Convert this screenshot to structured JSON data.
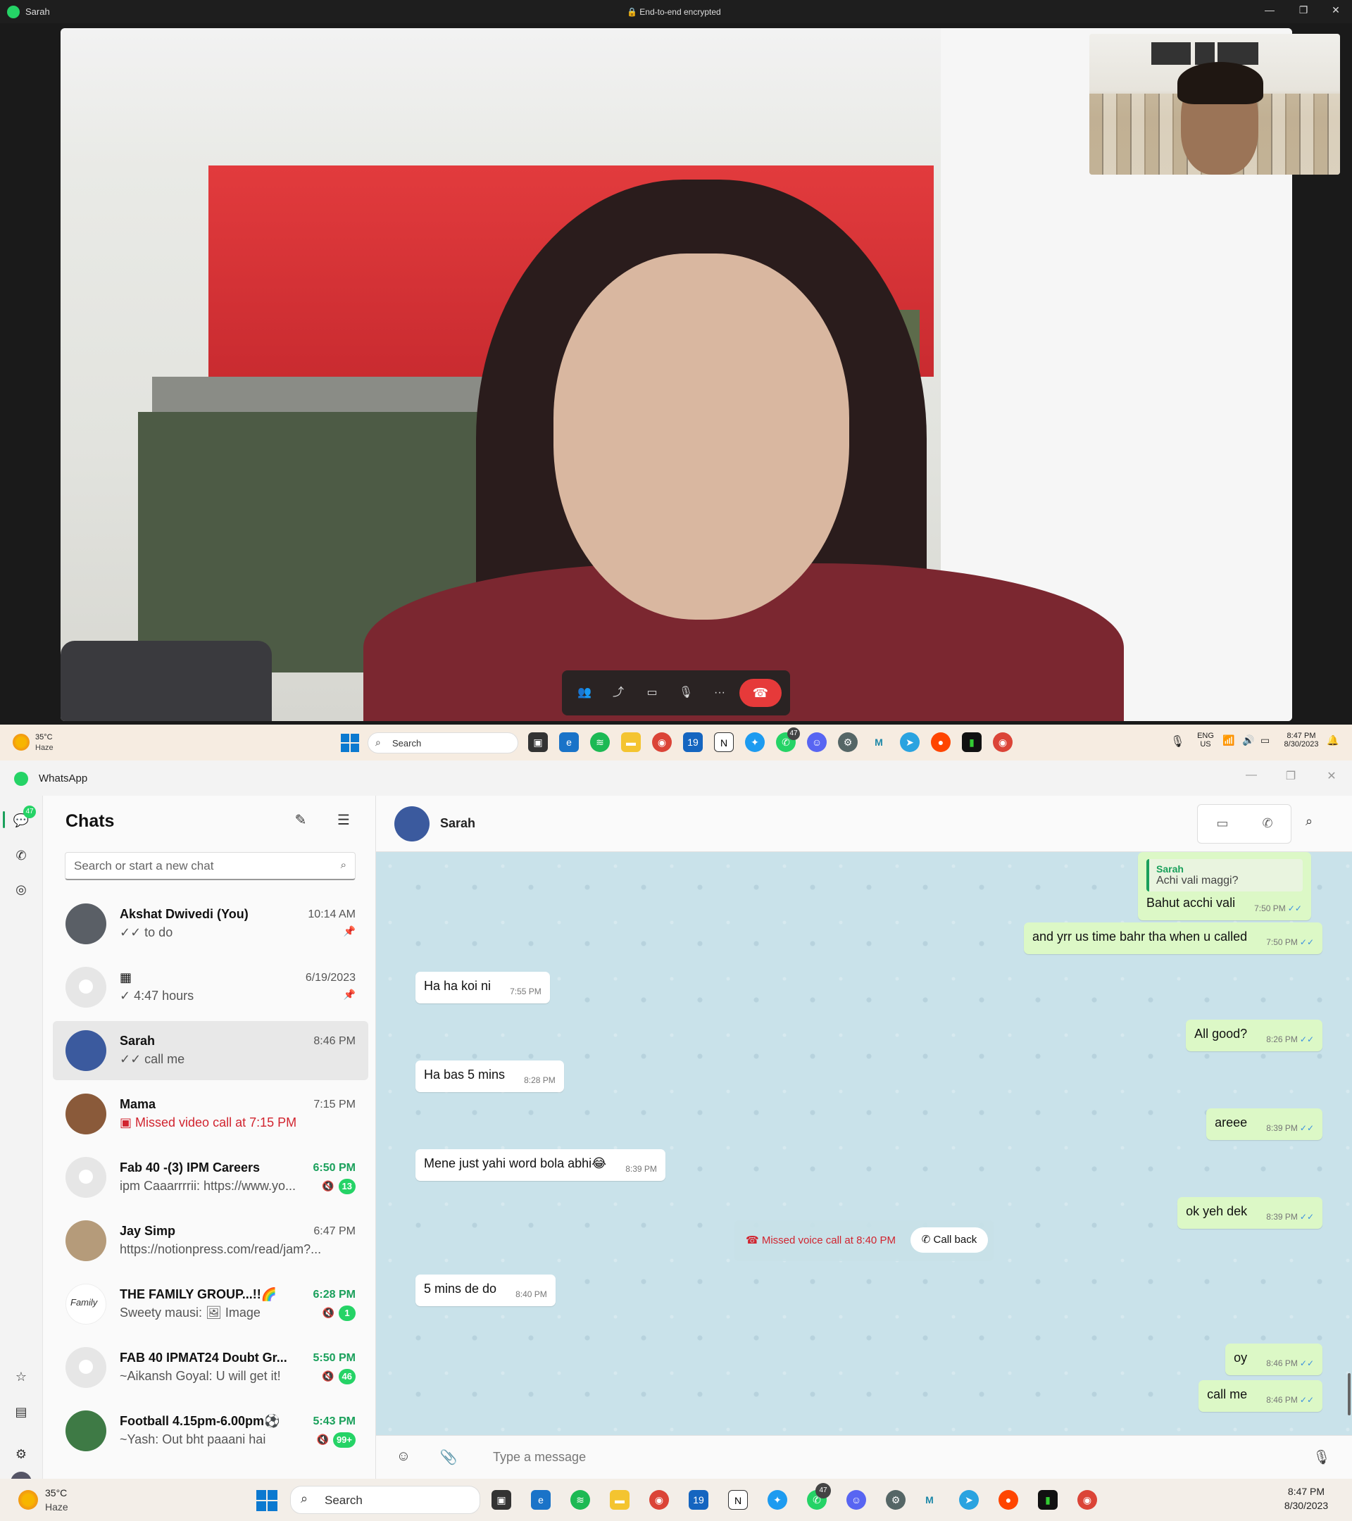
{
  "call_window": {
    "title": "Sarah",
    "encryption_text": "End-to-end encrypted",
    "window_controls": {
      "minimize": "—",
      "maximize": "❐",
      "close": "✕"
    },
    "controls": {
      "participants": "👥",
      "share": "⤴",
      "video": "▭",
      "mic": "🎙",
      "more": "···",
      "end": "☎"
    }
  },
  "taskbar_top": {
    "temp": "35°C",
    "condition": "Haze",
    "search_placeholder": "Search",
    "lang_top": "ENG",
    "lang_bottom": "US",
    "time": "8:47 PM",
    "date": "8/30/2023",
    "whatsapp_badge": "47"
  },
  "taskbar_bottom": {
    "temp": "35°C",
    "condition": "Haze",
    "search_placeholder": "Search",
    "time": "8:47 PM",
    "date": "8/30/2023",
    "whatsapp_badge": "47"
  },
  "whatsapp": {
    "app_title": "WhatsApp",
    "rail": {
      "chats_badge": "47"
    },
    "sidebar": {
      "title": "Chats",
      "search_placeholder": "Search or start a new chat",
      "chats": [
        {
          "name": "Akshat Dwivedi (You)",
          "time": "10:14 AM",
          "preview": "✓✓ to do",
          "pinned": "📌"
        },
        {
          "name": "▦",
          "time": "6/19/2023",
          "preview": "✓ 4:47 hours",
          "pinned": "📌"
        },
        {
          "name": "Sarah",
          "time": "8:46 PM",
          "preview": "✓✓ call me"
        },
        {
          "name": "Mama",
          "time": "7:15 PM",
          "preview": "Missed video call at 7:15 PM"
        },
        {
          "name": "Fab 40 -(3) IPM Careers",
          "time": "6:50 PM",
          "preview": "ipm Caaarrrrii: https://www.yo...",
          "badge": "13"
        },
        {
          "name": "Jay Simp",
          "time": "6:47 PM",
          "preview": "https://notionpress.com/read/jam?..."
        },
        {
          "name": "THE FAMILY GROUP...!!🌈",
          "time": "6:28 PM",
          "preview": "Sweety mausi: 🖼 Image",
          "badge": "1"
        },
        {
          "name": "FAB 40 IPMAT24 Doubt Gr...",
          "time": "5:50 PM",
          "preview": "~Aikansh Goyal: U will get it!",
          "badge": "46"
        },
        {
          "name": "Football 4.15pm-6.00pm⚽",
          "time": "5:43 PM",
          "preview": "~Yash: Out bht paaani hai",
          "badge": "99+"
        }
      ]
    },
    "conversation": {
      "contact_name": "Sarah",
      "messages": [
        {
          "dir": "out",
          "quote_name": "Sarah",
          "quote_text": "Achi vali maggi?",
          "text": "Bahut acchi vali",
          "time": "7:50 PM"
        },
        {
          "dir": "out",
          "text": "and yrr us time bahr tha when u called",
          "time": "7:50 PM"
        },
        {
          "dir": "in",
          "text": "Ha ha koi ni",
          "time": "7:55 PM"
        },
        {
          "dir": "out",
          "text": "All good?",
          "time": "8:26 PM"
        },
        {
          "dir": "in",
          "text": "Ha bas 5 mins",
          "time": "8:28 PM"
        },
        {
          "dir": "out",
          "text": "areee",
          "time": "8:39 PM"
        },
        {
          "dir": "in",
          "text": "Mene just yahi word bola abhi😂",
          "time": "8:39 PM"
        },
        {
          "dir": "out",
          "text": "ok yeh dek",
          "time": "8:39 PM"
        },
        {
          "dir": "in",
          "text": "5 mins de do",
          "time": "8:40 PM"
        },
        {
          "dir": "out",
          "text": "oy",
          "time": "8:46 PM"
        },
        {
          "dir": "out",
          "text": "call me",
          "time": "8:46 PM"
        }
      ],
      "missed_call": {
        "text": "Missed voice call at 8:40 PM",
        "button": "Call back"
      },
      "composer_placeholder": "Type a message"
    }
  },
  "colors": {
    "accent": "#25d366",
    "outgoing_bubble": "#dcf8c6",
    "missed": "#d1242f",
    "end_call": "#e63a3a"
  }
}
